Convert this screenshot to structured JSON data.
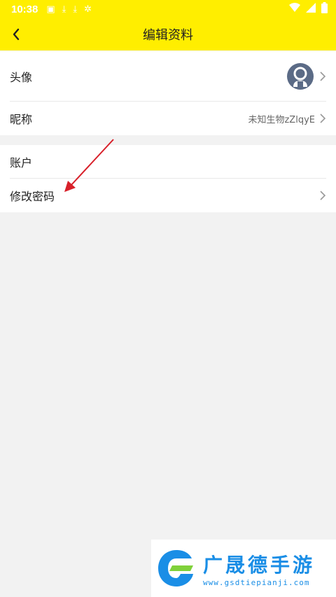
{
  "status_bar": {
    "time": "10:38",
    "icons": [
      "image-icon",
      "download-icon",
      "download-icon",
      "app-icon"
    ],
    "right_icons": [
      "wifi-icon",
      "signal-icon",
      "battery-icon"
    ]
  },
  "header": {
    "title": "编辑资料",
    "back_icon": "chevron-left-icon",
    "background": "#ffee00"
  },
  "profile_section": {
    "avatar": {
      "label": "头像",
      "icon": "avatar-icon"
    },
    "nickname": {
      "label": "昵称",
      "value": "未知生物zZlqyE"
    }
  },
  "account_section": {
    "account": {
      "label": "账户"
    },
    "change_password": {
      "label": "修改密码"
    }
  },
  "watermark": {
    "title": "广晟德手游",
    "url": "www.gsdtiepianji.com"
  },
  "colors": {
    "accent": "#ffee00",
    "annotation_arrow": "#d8202a",
    "watermark_blue": "#1a8ee6"
  }
}
